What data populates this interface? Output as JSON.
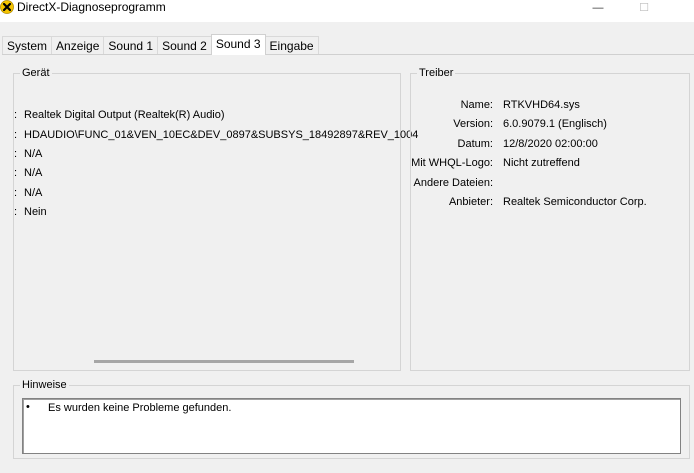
{
  "window": {
    "title": "DirectX-Diagnoseprogramm",
    "minimize_glyph": "—",
    "maximize_glyph": "☐"
  },
  "tabs": [
    {
      "label": "System"
    },
    {
      "label": "Anzeige"
    },
    {
      "label": "Sound 1"
    },
    {
      "label": "Sound 2"
    },
    {
      "label": "Sound 3",
      "active": true
    },
    {
      "label": "Eingabe"
    }
  ],
  "device": {
    "title": "Gerät",
    "lines": [
      {
        "sep": ":",
        "value": "Realtek Digital Output (Realtek(R) Audio)"
      },
      {
        "sep": ":",
        "value": "HDAUDIO\\FUNC_01&VEN_10EC&DEV_0897&SUBSYS_18492897&REV_1004"
      },
      {
        "sep": ":",
        "value": "N/A"
      },
      {
        "sep": ":",
        "value": "N/A"
      },
      {
        "sep": ":",
        "value": "N/A"
      },
      {
        "sep": ":",
        "value": "Nein"
      }
    ]
  },
  "driver": {
    "title": "Treiber",
    "rows": [
      {
        "label": "Name:",
        "value": "RTKVHD64.sys"
      },
      {
        "label": "Version:",
        "value": "6.0.9079.1 (Englisch)"
      },
      {
        "label": "Datum:",
        "value": "12/8/2020 02:00:00"
      },
      {
        "label": "Mit WHQL-Logo:",
        "value": "Nicht zutreffend"
      },
      {
        "label": "Andere Dateien:",
        "value": ""
      },
      {
        "label": "Anbieter:",
        "value": "Realtek Semiconductor Corp."
      }
    ]
  },
  "notes": {
    "title": "Hinweise",
    "items": [
      "Es wurden keine Probleme gefunden."
    ]
  },
  "colors": {
    "background": "#f0f0f0",
    "app_icon_yellow": "#f5c400"
  }
}
